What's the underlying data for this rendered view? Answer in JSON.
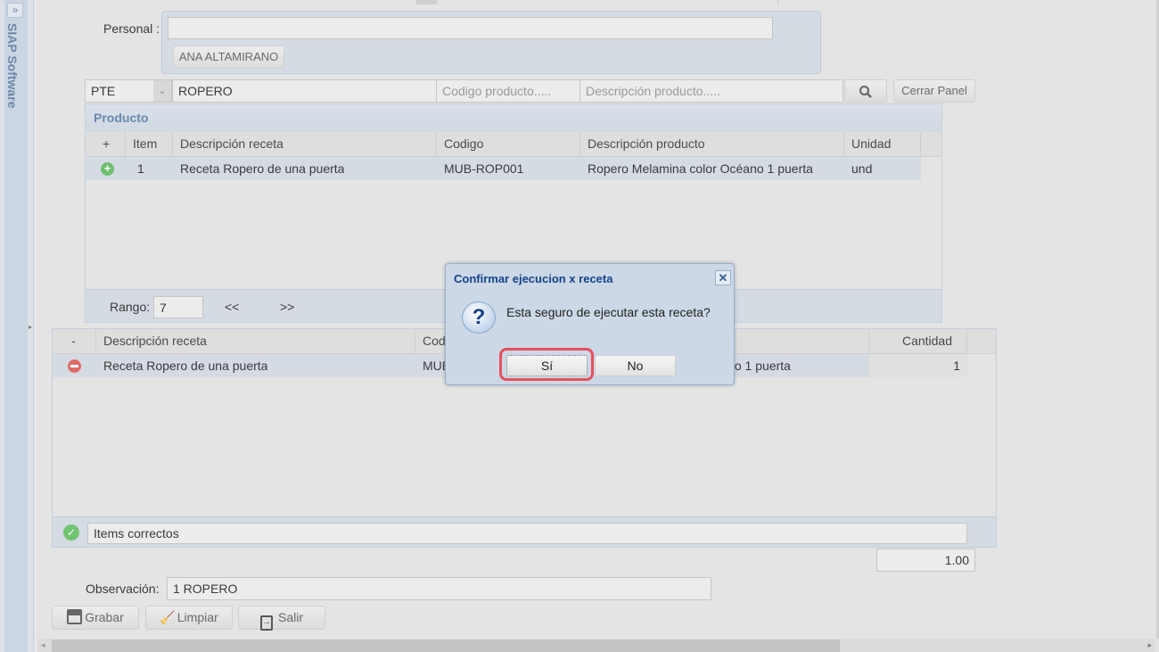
{
  "sidebar": {
    "title": "SIAP Software",
    "expand_icon": "double-chevron-right-icon"
  },
  "personal": {
    "label": "Personal :",
    "value": "",
    "employee_button": "ANA ALTAMIRANO"
  },
  "filters": {
    "type_value": "PTE",
    "name_value": "ROPERO",
    "code_placeholder": "Codigo producto.....",
    "desc_placeholder": "Descripción producto.....",
    "search_icon": "search-icon",
    "close_panel": "Cerrar Panel"
  },
  "product_panel": {
    "title": "Producto",
    "columns": [
      "+",
      "Item",
      "Descripción receta",
      "Codigo",
      "Descripción producto",
      "Unidad"
    ],
    "rows": [
      {
        "item": "1",
        "recipe": "Receta Ropero de una puerta",
        "code": "MUB-ROP001",
        "product": "Ropero Melamina color Océano 1 puerta",
        "unit": "und"
      }
    ],
    "range_label": "Rango:",
    "range_value": "7",
    "prev": "<<",
    "next": ">>"
  },
  "selected_grid": {
    "columns": [
      "-",
      "Descripción receta",
      "Codigo",
      "Descripción producto",
      "Cantidad"
    ],
    "rows": [
      {
        "recipe": "Receta Ropero de una puerta",
        "code": "MUB-ROP001",
        "product": "Ropero Melamina color Océano 1 puerta",
        "qty": "1"
      }
    ],
    "status": "Items correctos",
    "total": "1.00"
  },
  "observation": {
    "label": "Observación:",
    "value": "1 ROPERO"
  },
  "actions": {
    "save": "Grabar",
    "clear": "Limpiar",
    "exit": "Salir"
  },
  "dialog": {
    "title": "Confirmar ejecucion x receta",
    "message": "Esta seguro de ejecutar esta receta?",
    "yes": "Sí",
    "no": "No",
    "highlight_color": "#e8505b"
  }
}
